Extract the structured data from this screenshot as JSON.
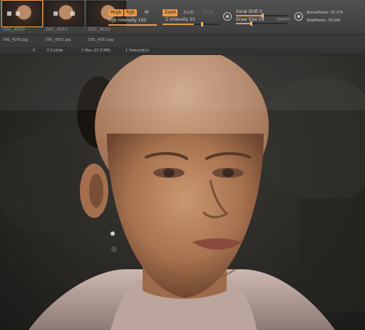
{
  "thumbnails": [
    {
      "caption": "DSC_4250",
      "active": true
    },
    {
      "caption": "DSC_4251",
      "active": false
    },
    {
      "caption": "DSC_4252",
      "active": false
    }
  ],
  "toolbar": {
    "mrgb_label": "Mrgb",
    "rgb_label": "Rgb",
    "m_label": "M",
    "zadd_label": "Zadd",
    "zsub_label": "Zsub",
    "zcut_label": "Zcut",
    "rgb_intensity_label": "Rgb Intensity 100",
    "z_intensity_label": "Z Intensity 55",
    "focal_shift_label": "Focal Shift 0",
    "draw_size_label": "Draw Size 59",
    "dynamic_label": "Dynamic",
    "active_points_label": "ActivePoints: 37,275",
    "total_points_label": "TotalPoints: 74,550",
    "rgb_intensity": 100,
    "z_intensity": 55,
    "focal_shift": 0,
    "draw_size": 59,
    "accent": "#e89a4a"
  },
  "tray": {
    "files": [
      "DSC_4250.jpg",
      "DSC_4251.jpg",
      "DSC_4252.jpg"
    ],
    "status": [
      "0",
      "0 Cull/de",
      "1 files (37.6 MB)",
      "1 Selected(s)"
    ]
  }
}
